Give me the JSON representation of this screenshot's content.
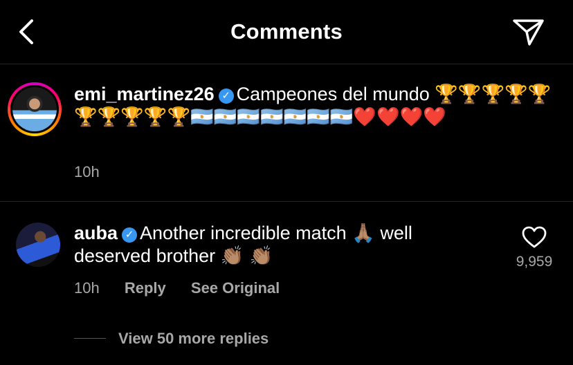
{
  "header": {
    "title": "Comments",
    "back_icon": "chevron-left-icon",
    "send_icon": "send-paper-plane-icon"
  },
  "caption": {
    "username": "emi_martinez26",
    "text": "Campeones del mundo",
    "emoji_line": "🏆🏆🏆🏆🏆🏆🏆🏆🏆🏆🇦🇷🇦🇷🇦🇷🇦🇷🇦🇷🇦🇷🇦🇷❤️❤️❤️❤️",
    "time": "10h"
  },
  "comment": {
    "username": "auba",
    "text_line1": "Another incredible match",
    "emoji_pray": "🙏🏽",
    "text_line1_end": "well",
    "text_line2": "deserved brother",
    "emoji_clap": "👏🏽 👏🏽",
    "time": "10h",
    "reply_label": "Reply",
    "see_original_label": "See Original",
    "likes": "9,959",
    "view_replies_label": "View 50 more replies"
  },
  "colors": {
    "background": "#000000",
    "text": "#ffffff",
    "secondary_text": "#a8a8a8",
    "verified_badge": "#3897f0",
    "divider": "#262626"
  }
}
